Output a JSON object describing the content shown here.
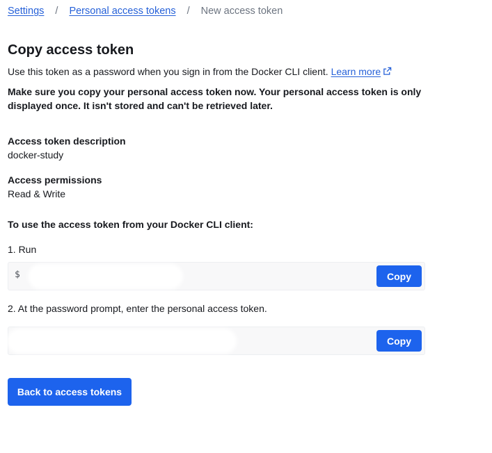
{
  "breadcrumb": {
    "items": [
      {
        "label": "Settings"
      },
      {
        "label": "Personal access tokens"
      },
      {
        "label": "New access token"
      }
    ],
    "separator": "/"
  },
  "page": {
    "title": "Copy access token",
    "description": "Use this token as a password when you sign in from the Docker CLI client.",
    "learn_more": "Learn more",
    "warning": "Make sure you copy your personal access token now. Your personal access token is only displayed once. It isn't stored and can't be retrieved later."
  },
  "token_info": {
    "description_label": "Access token description",
    "description_value": "docker-study",
    "permissions_label": "Access permissions",
    "permissions_value": "Read & Write"
  },
  "instructions": {
    "title": "To use the access token from your Docker CLI client:",
    "step1": "1. Run",
    "step1_prompt": "$",
    "step2": "2. At the password prompt, enter the personal access token.",
    "copy_label": "Copy"
  },
  "actions": {
    "back_label": "Back to access tokens"
  },
  "colors": {
    "accent": "#1d63ed",
    "link": "#2560d8"
  }
}
